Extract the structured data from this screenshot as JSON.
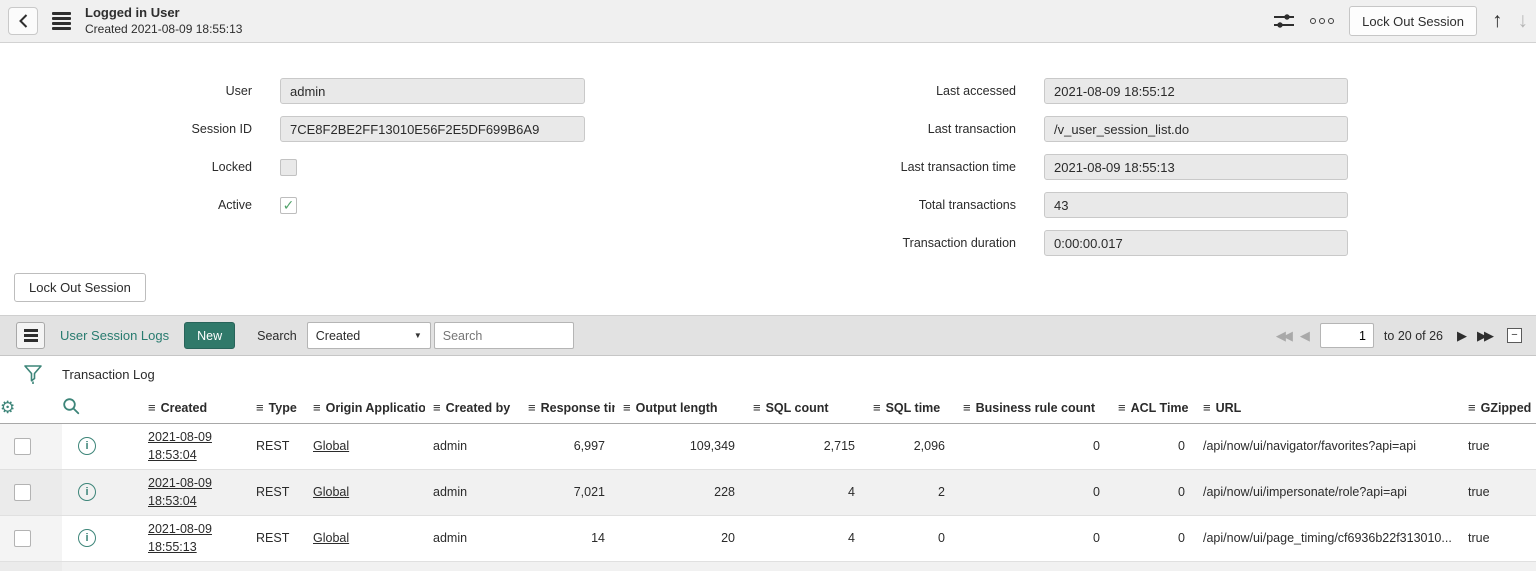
{
  "colors": {
    "accent_teal": "#30796a",
    "link_teal": "#287b6f",
    "icon_teal": "#3d8579",
    "check_green": "#52a36b",
    "topbar_bg": "#f0f0f0",
    "caption_bg": "#e2e2e2",
    "readonly_field_bg": "#e9e9e9",
    "row_stripe": "#f1f1f1"
  },
  "icons": {
    "col_menu": "≡",
    "gear": "⚙",
    "check": "✓",
    "info": "i",
    "up_arrow": "↑",
    "down_arrow": "↓",
    "prev": "◀",
    "next": "▶",
    "caret_down": "▼",
    "collapse": "−"
  },
  "topbar": {
    "title": "Logged in User",
    "subtitle": "Created 2021-08-09 18:55:13",
    "lockout_button": "Lock Out Session"
  },
  "form": {
    "left": [
      {
        "label": "User",
        "value": "admin"
      },
      {
        "label": "Session ID",
        "value": "7CE8F2BE2FF13010E56F2E5DF699B6A9"
      },
      {
        "label": "Locked",
        "checked": false
      },
      {
        "label": "Active",
        "checked": true
      }
    ],
    "right": [
      {
        "label": "Last accessed",
        "value": "2021-08-09 18:55:12"
      },
      {
        "label": "Last transaction",
        "value": "/v_user_session_list.do"
      },
      {
        "label": "Last transaction time",
        "value": "2021-08-09 18:55:13"
      },
      {
        "label": "Total transactions",
        "value": "43"
      },
      {
        "label": "Transaction duration",
        "value": "0:00:00.017"
      }
    ],
    "lockout_button": "Lock Out Session"
  },
  "list": {
    "title": "User Session Logs",
    "new_button": "New",
    "search_label": "Search",
    "search_column": "Created",
    "search_placeholder": "Search",
    "pagination": {
      "page": "1",
      "range": "to 20 of 26"
    },
    "filter_title": "Transaction Log",
    "columns": [
      "Created",
      "Type",
      "Origin Application",
      "Created by",
      "Response time",
      "Output length",
      "SQL count",
      "SQL time",
      "Business rule count",
      "ACL Time",
      "URL",
      "GZipped"
    ],
    "rows": [
      {
        "created_date": "2021-08-09",
        "created_time": "18:53:04",
        "type": "REST",
        "origin": "Global",
        "created_by": "admin",
        "response_time": "6,997",
        "output_length": "109,349",
        "sql_count": "2,715",
        "sql_time": "2,096",
        "business_rule_count": "0",
        "acl_time": "0",
        "url": "/api/now/ui/navigator/favorites?api=api",
        "gzipped": "true"
      },
      {
        "created_date": "2021-08-09",
        "created_time": "18:53:04",
        "type": "REST",
        "origin": "Global",
        "created_by": "admin",
        "response_time": "7,021",
        "output_length": "228",
        "sql_count": "4",
        "sql_time": "2",
        "business_rule_count": "0",
        "acl_time": "0",
        "url": "/api/now/ui/impersonate/role?api=api",
        "gzipped": "true"
      },
      {
        "created_date": "2021-08-09",
        "created_time": "18:55:13",
        "type": "REST",
        "origin": "Global",
        "created_by": "admin",
        "response_time": "14",
        "output_length": "20",
        "sql_count": "4",
        "sql_time": "0",
        "business_rule_count": "0",
        "acl_time": "0",
        "url": "/api/now/ui/page_timing/cf6936b22f313010...",
        "gzipped": "true"
      }
    ]
  }
}
